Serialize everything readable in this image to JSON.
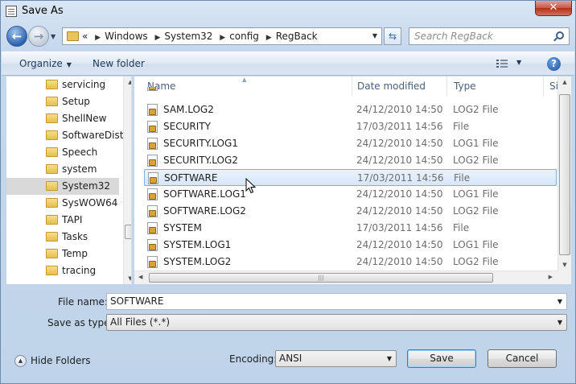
{
  "window": {
    "title": "Save As",
    "close_label": "✕"
  },
  "nav": {
    "back_glyph": "←",
    "forward_glyph": "→",
    "address_overflow": "«",
    "breadcrumbs": [
      "Windows",
      "System32",
      "config",
      "RegBack"
    ],
    "search_placeholder": "Search RegBack"
  },
  "toolbar": {
    "organize_label": "Organize",
    "new_folder_label": "New folder",
    "help_label": "?"
  },
  "tree": {
    "items": [
      {
        "label": "servicing",
        "selected": false
      },
      {
        "label": "Setup",
        "selected": false
      },
      {
        "label": "ShellNew",
        "selected": false
      },
      {
        "label": "SoftwareDistri",
        "selected": false
      },
      {
        "label": "Speech",
        "selected": false
      },
      {
        "label": "system",
        "selected": false
      },
      {
        "label": "System32",
        "selected": true
      },
      {
        "label": "SysWOW64",
        "selected": false
      },
      {
        "label": "TAPI",
        "selected": false
      },
      {
        "label": "Tasks",
        "selected": false
      },
      {
        "label": "Temp",
        "selected": false
      },
      {
        "label": "tracing",
        "selected": false
      }
    ]
  },
  "file_list": {
    "columns": {
      "name": "Name",
      "date": "Date modified",
      "type": "Type",
      "size": "Si"
    },
    "rows": [
      {
        "name": "SAM.LOG2",
        "date": "24/12/2010 14:50",
        "type": "LOG2 File",
        "selected": false
      },
      {
        "name": "SECURITY",
        "date": "17/03/2011 14:56",
        "type": "File",
        "selected": false
      },
      {
        "name": "SECURITY.LOG1",
        "date": "24/12/2010 14:50",
        "type": "LOG1 File",
        "selected": false
      },
      {
        "name": "SECURITY.LOG2",
        "date": "24/12/2010 14:50",
        "type": "LOG2 File",
        "selected": false
      },
      {
        "name": "SOFTWARE",
        "date": "17/03/2011 14:56",
        "type": "File",
        "selected": true
      },
      {
        "name": "SOFTWARE.LOG1",
        "date": "24/12/2010 14:50",
        "type": "LOG1 File",
        "selected": false
      },
      {
        "name": "SOFTWARE.LOG2",
        "date": "24/12/2010 14:50",
        "type": "LOG2 File",
        "selected": false
      },
      {
        "name": "SYSTEM",
        "date": "17/03/2011 14:56",
        "type": "File",
        "selected": false
      },
      {
        "name": "SYSTEM.LOG1",
        "date": "24/12/2010 14:50",
        "type": "LOG1 File",
        "selected": false
      },
      {
        "name": "SYSTEM.LOG2",
        "date": "24/12/2010 14:50",
        "type": "LOG2 File",
        "selected": false
      }
    ]
  },
  "form": {
    "file_name_label": "File name:",
    "file_name_value": "SOFTWARE",
    "save_as_type_label": "Save as type:",
    "save_as_type_value": "All Files  (*.*)",
    "encoding_label": "Encoding:",
    "encoding_value": "ANSI"
  },
  "footer": {
    "hide_folders_label": "Hide Folders",
    "save_label": "Save",
    "cancel_label": "Cancel"
  },
  "colors": {
    "selection_bg": "#d5e7fb",
    "selection_border": "#84acdd",
    "toolbar_text": "#1e395b"
  }
}
